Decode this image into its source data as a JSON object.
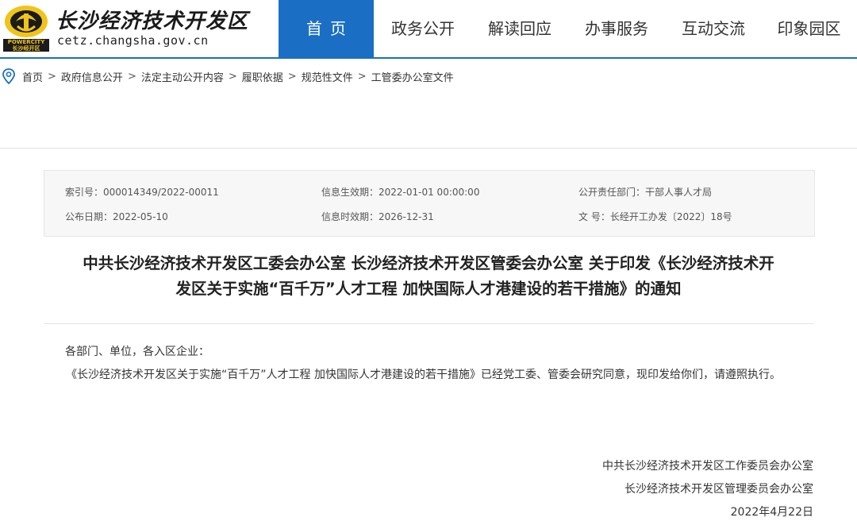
{
  "header": {
    "logo_brand": "POWERCITY",
    "logo_brand_sub": "长沙经开区",
    "site_title": "长沙经济技术开发区",
    "site_domain": "cetz.changsha.gov.cn"
  },
  "nav": {
    "items": [
      {
        "label": "首页"
      },
      {
        "label": "政务公开"
      },
      {
        "label": "解读回应"
      },
      {
        "label": "办事服务"
      },
      {
        "label": "互动交流"
      },
      {
        "label": "印象园区"
      }
    ],
    "active_index": 0
  },
  "breadcrumb": {
    "icon": "location-pin-icon",
    "items": [
      "首页",
      "政府信息公开",
      "法定主动公开内容",
      "履职依据",
      "规范性文件",
      "工管委办公室文件"
    ],
    "separator": ">"
  },
  "meta": {
    "index_no": "索引号：000014349/2022-00011",
    "effective_date": "信息生效期：2022-01-01 00:00:00",
    "department": "公开责任部门：干部人事人才局",
    "publish_date": "公布日期：2022-05-10",
    "expiry_date": "信息时效期：2026-12-31",
    "doc_no": "文 号：长经开工办发〔2022〕18号"
  },
  "document": {
    "title_line1": "中共长沙经济技术开发区工委会办公室 长沙经济技术开发区管委会办公室 关于印发《长沙经济技术开",
    "title_line2": "发区关于实施“百千万”人才工程 加快国际人才港建设的若干措施》的通知",
    "salutation": "各部门、单位，各入区企业：",
    "paragraph": "《长沙经济技术开发区关于实施“百千万”人才工程 加快国际人才港建设的若干措施》已经党工委、管委会研究同意，现印发给你们，请遵照执行。",
    "signer1": "中共长沙经济技术开发区工作委员会办公室",
    "signer2": "长沙经济技术开发区管理委员会办公室",
    "date": "2022年4月22日"
  },
  "colors": {
    "accent": "#1a6fc4",
    "logo_gold": "#f0c419"
  }
}
